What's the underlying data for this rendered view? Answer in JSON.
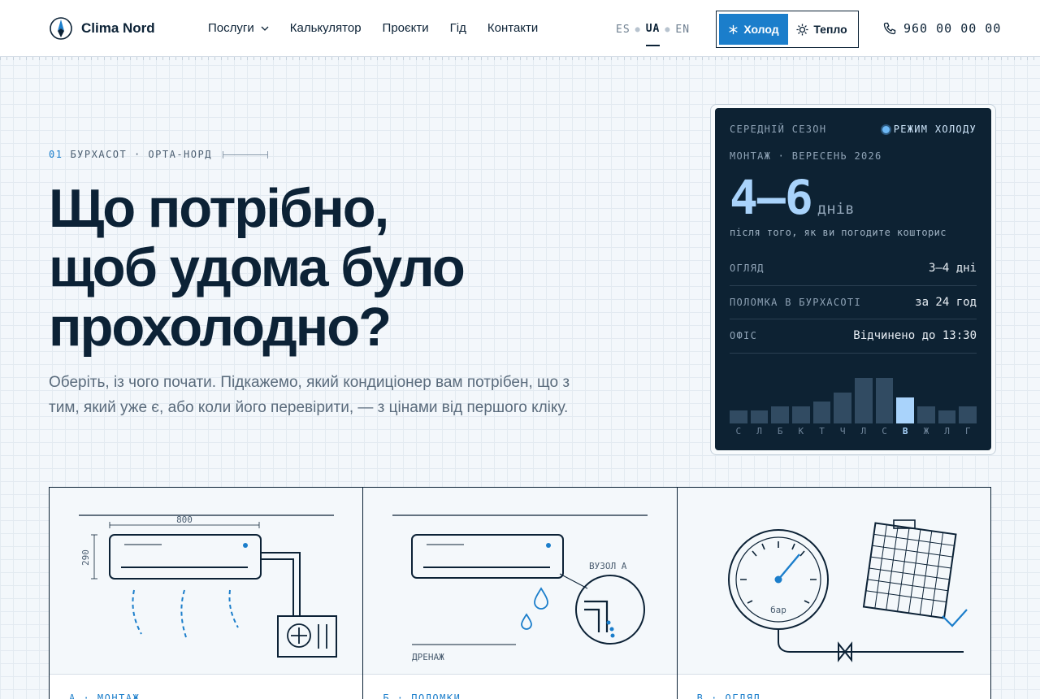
{
  "header": {
    "brand": "Clima Nord",
    "nav": [
      "Послуги",
      "Калькулятор",
      "Проєкти",
      "Гід",
      "Контакти"
    ],
    "languages": [
      {
        "code": "ES",
        "active": false
      },
      {
        "code": "UA",
        "active": true
      },
      {
        "code": "EN",
        "active": false
      }
    ],
    "mode": {
      "cold": "Холод",
      "warm": "Тепло",
      "selected": "cold"
    },
    "phone": "960 00 00 00"
  },
  "hero": {
    "eyebrow_num": "01",
    "eyebrow": "БУРХАСОТ · ОРТА-НОРД",
    "title_lines": [
      "Що потрібно,",
      "щоб удома було",
      "прохолодно?"
    ],
    "subtitle": "Оберіть, із чого почати. Підкажемо, який кондиціонер вам потрібен, що з тим, який уже є, або коли його перевірити, — з цінами від першого кліку."
  },
  "season_card": {
    "label": "СЕРЕДНІЙ СЕЗОН",
    "badge": "РЕЖИМ ХОЛОДУ",
    "subtitle": "МОНТАЖ · ВЕРЕСЕНЬ 2026",
    "value": "4–6",
    "unit": "днів",
    "note": "після того, як ви погодите кошторис",
    "rows": [
      {
        "label": "ОГЛЯД",
        "value": "3–4 дні"
      },
      {
        "label": "ПОЛОМКА В БУРХАСОТІ",
        "value": "за 24 год"
      },
      {
        "label": "ОФІС",
        "value": "Відчинено до 13:30"
      }
    ],
    "months": [
      "С",
      "Л",
      "Б",
      "К",
      "Т",
      "Ч",
      "Л",
      "С",
      "В",
      "Ж",
      "Л",
      "Г"
    ],
    "load": [
      0.2,
      0.2,
      0.27,
      0.27,
      0.35,
      0.49,
      0.72,
      0.72,
      0.41,
      0.27,
      0.2,
      0.27
    ],
    "current_month_index": 8
  },
  "features": {
    "a": {
      "label": "А · МОНТАЖ",
      "width": "800",
      "height": "290"
    },
    "b": {
      "label": "Б · ПОЛОМКИ",
      "node": "ВУЗОЛ А",
      "drain": "ДРЕНАЖ"
    },
    "c": {
      "label": "В · ОГЛЯД",
      "gauge": "бар"
    }
  },
  "colors": {
    "accent": "#1b7ecb",
    "ink": "#0c2236",
    "card": "#0d2233",
    "highlight": "#a9d3fb"
  }
}
